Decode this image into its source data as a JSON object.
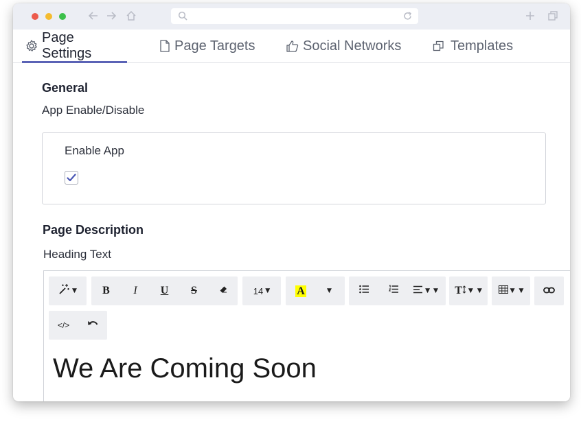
{
  "tabs": [
    {
      "label": "Page Settings",
      "icon": "gear-icon",
      "active": true
    },
    {
      "label": "Page Targets",
      "icon": "file-icon",
      "active": false
    },
    {
      "label": "Social Networks",
      "icon": "thumbs-up-icon",
      "active": false
    },
    {
      "label": "Templates",
      "icon": "copy-icon",
      "active": false
    }
  ],
  "general": {
    "title": "General",
    "subtitle": "App Enable/Disable",
    "enable_label": "Enable App",
    "enabled": true
  },
  "description": {
    "title": "Page Description",
    "heading_label": "Heading Text",
    "heading_value": "We Are Coming Soon"
  },
  "toolbar": {
    "bold": "B",
    "italic": "I",
    "underline": "U",
    "strike": "S",
    "font_size": "14",
    "highlight": "A",
    "text_size": "T",
    "code": "</>"
  },
  "colors": {
    "accent": "#5b63b6",
    "highlight": "#ffff00",
    "checkmark": "#4a57b5"
  }
}
